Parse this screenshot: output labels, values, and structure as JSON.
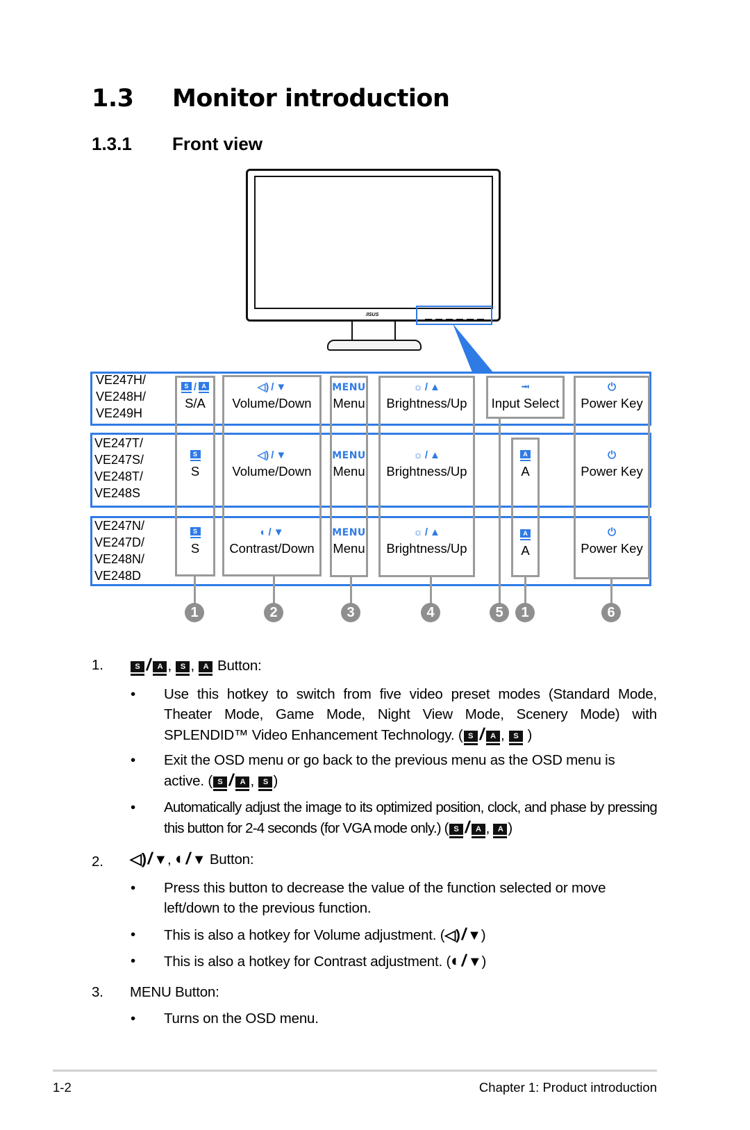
{
  "section": {
    "number": "1.3",
    "title": "Monitor introduction"
  },
  "subsection": {
    "number": "1.3.1",
    "title": "Front view"
  },
  "monitor": {
    "logo": "/ISUS"
  },
  "colors": {
    "accent": "#2f7be6",
    "frame_gray": "#9a9a9a",
    "callout_gray": "#8f8f8f"
  },
  "table": {
    "rows": [
      {
        "models": [
          "VE247H/",
          "VE248H/",
          "VE249H"
        ],
        "buttons": [
          {
            "icon": "s-a-mode-icon",
            "label": "S/A"
          },
          {
            "icon": "volume-down-icon",
            "label": "Volume/Down"
          },
          {
            "icon": "menu-icon",
            "icon_text": "MENU",
            "label": "Menu"
          },
          {
            "icon": "brightness-up-icon",
            "label": "Brightness/Up"
          },
          {
            "icon": "input-select-icon",
            "label": "Input Select"
          },
          {
            "icon": "power-icon",
            "label": "Power Key"
          }
        ]
      },
      {
        "models": [
          "VE247T/",
          "VE247S/",
          "VE248T/",
          "VE248S"
        ],
        "buttons": [
          {
            "icon": "s-mode-icon",
            "label": "S"
          },
          {
            "icon": "volume-down-icon",
            "label": "Volume/Down"
          },
          {
            "icon": "menu-icon",
            "icon_text": "MENU",
            "label": "Menu"
          },
          {
            "icon": "brightness-up-icon",
            "label": "Brightness/Up"
          },
          {
            "icon": "a-mode-icon",
            "label": "A"
          },
          {
            "icon": "power-icon",
            "label": "Power Key"
          }
        ]
      },
      {
        "models": [
          "VE247N/",
          "VE247D/",
          "VE248N/",
          "VE248D"
        ],
        "buttons": [
          {
            "icon": "s-mode-icon",
            "label": "S"
          },
          {
            "icon": "contrast-down-icon",
            "label": "Contrast/Down"
          },
          {
            "icon": "menu-icon",
            "icon_text": "MENU",
            "label": "Menu"
          },
          {
            "icon": "brightness-up-icon",
            "label": "Brightness/Up"
          },
          {
            "icon": "a-mode-icon",
            "label": "A"
          },
          {
            "icon": "power-icon",
            "label": "Power Key"
          }
        ]
      }
    ],
    "callouts": [
      "1",
      "2",
      "3",
      "4",
      "5",
      "1",
      "6"
    ]
  },
  "items": [
    {
      "number": "1.",
      "heading_suffix": "Button:",
      "bullets": [
        {
          "text": "Use this hotkey to switch from five video preset modes (Standard Mode, Theater Mode, Game Mode, Night View Mode, Scenery Mode) with SPLENDID™ Video Enhancement Technology. ("
        },
        {
          "text": "Exit the OSD menu or go back to the previous menu as the OSD menu is active. ("
        },
        {
          "text": "Automatically adjust the image to its optimized position, clock, and phase by pressing this button for 2-4 seconds (for VGA mode only.) ("
        }
      ]
    },
    {
      "number": "2.",
      "heading_suffix": "Button:",
      "bullets": [
        {
          "text": "Press this button to decrease the value of the function selected or move left/down to the previous function."
        },
        {
          "text": "This is also a hotkey for Volume adjustment. ("
        },
        {
          "text": "This is also a hotkey for Contrast adjustment. ("
        }
      ]
    },
    {
      "number": "3.",
      "heading": "MENU Button:",
      "bullets": [
        {
          "text": "Turns on the OSD menu."
        }
      ]
    }
  ],
  "glyphs": {
    "s": "S",
    "a": "A",
    "slash": "/",
    "comma": ",",
    "close": ")",
    "bullet": "•",
    "speaker": "◁)",
    "contrast": "◐",
    "down": "▼",
    "up": "▲",
    "sun": "☼",
    "power": "⏻",
    "input": "⭲"
  },
  "footer": {
    "page": "1-2",
    "chapter": "Chapter 1: Product introduction"
  }
}
